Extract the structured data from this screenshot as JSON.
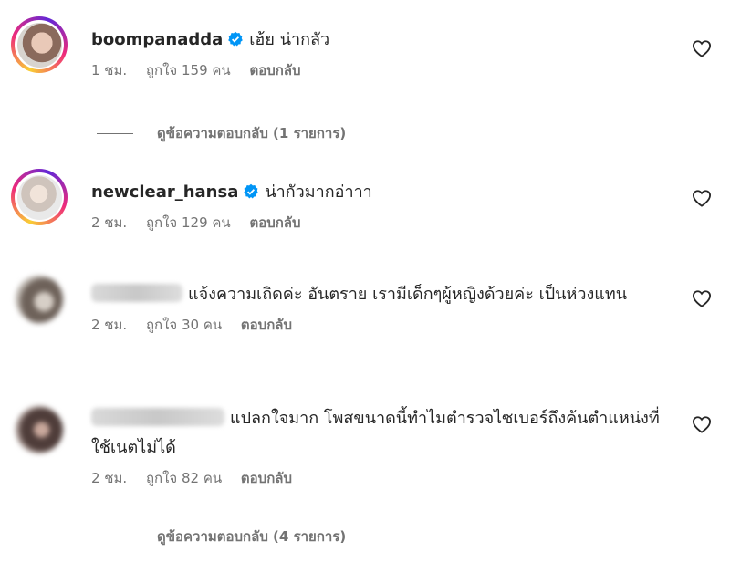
{
  "comments": [
    {
      "username": "boompanadda",
      "verified": true,
      "text": "เฮ้ย น่ากลัว",
      "time": "1 ชม.",
      "likes": "ถูกใจ 159 คน",
      "reply_label": "ตอบกลับ"
    },
    {
      "username": "newclear_hansa",
      "verified": true,
      "text": "น่ากัวมากอ่าาา",
      "time": "2 ชม.",
      "likes": "ถูกใจ 129 คน",
      "reply_label": "ตอบกลับ"
    },
    {
      "username": "",
      "verified": false,
      "text": "แจ้งความเถิดค่ะ อันตราย เรามีเด็กๆผู้หญิงด้วยค่ะ เป็นห่วงแทน",
      "time": "2 ชม.",
      "likes": "ถูกใจ 30 คน",
      "reply_label": "ตอบกลับ"
    },
    {
      "username": "",
      "verified": false,
      "text": "แปลกใจมาก โพสขนาดนี้ทำไมตำรวจไซเบอร์ถึงค้นตำแหน่งที่ใช้เนตไม่ได้",
      "time": "2 ชม.",
      "likes": "ถูกใจ 82 คน",
      "reply_label": "ตอบกลับ"
    }
  ],
  "view_replies": [
    "ดูข้อความตอบกลับ (1 รายการ)",
    "ดูข้อความตอบกลับ (4 รายการ)"
  ],
  "colors": {
    "text": "#262626",
    "secondary": "#737373",
    "verified": "#0095f6"
  },
  "icons": {
    "like": "heart-outline-icon",
    "verified": "verified-badge-icon"
  }
}
